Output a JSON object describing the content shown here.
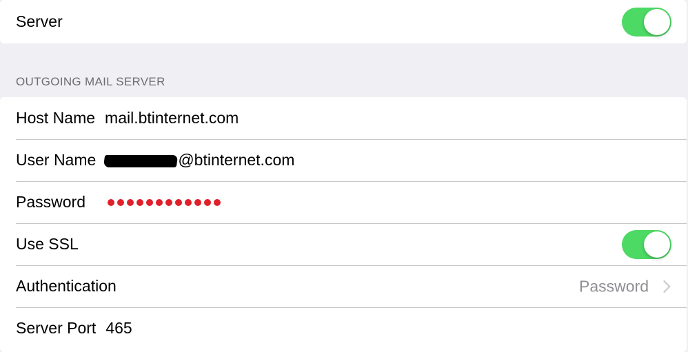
{
  "top_group": {
    "server_label": "Server",
    "server_toggle_on": true
  },
  "outgoing": {
    "section_header": "OUTGOING MAIL SERVER",
    "host_name_label": "Host Name",
    "host_name_value": "mail.btinternet.com",
    "user_name_label": "User Name",
    "user_name_domain": "@btinternet.com",
    "password_label": "Password",
    "password_dot_count": 12,
    "use_ssl_label": "Use SSL",
    "use_ssl_on": true,
    "authentication_label": "Authentication",
    "authentication_value": "Password",
    "server_port_label": "Server Port",
    "server_port_value": "465"
  },
  "colors": {
    "toggle_on": "#4cd964",
    "password_dot": "#e0202a",
    "background": "#efeff4",
    "secondary_text": "#8e8e93"
  },
  "icons": {
    "disclosure": "chevron-right-icon"
  }
}
